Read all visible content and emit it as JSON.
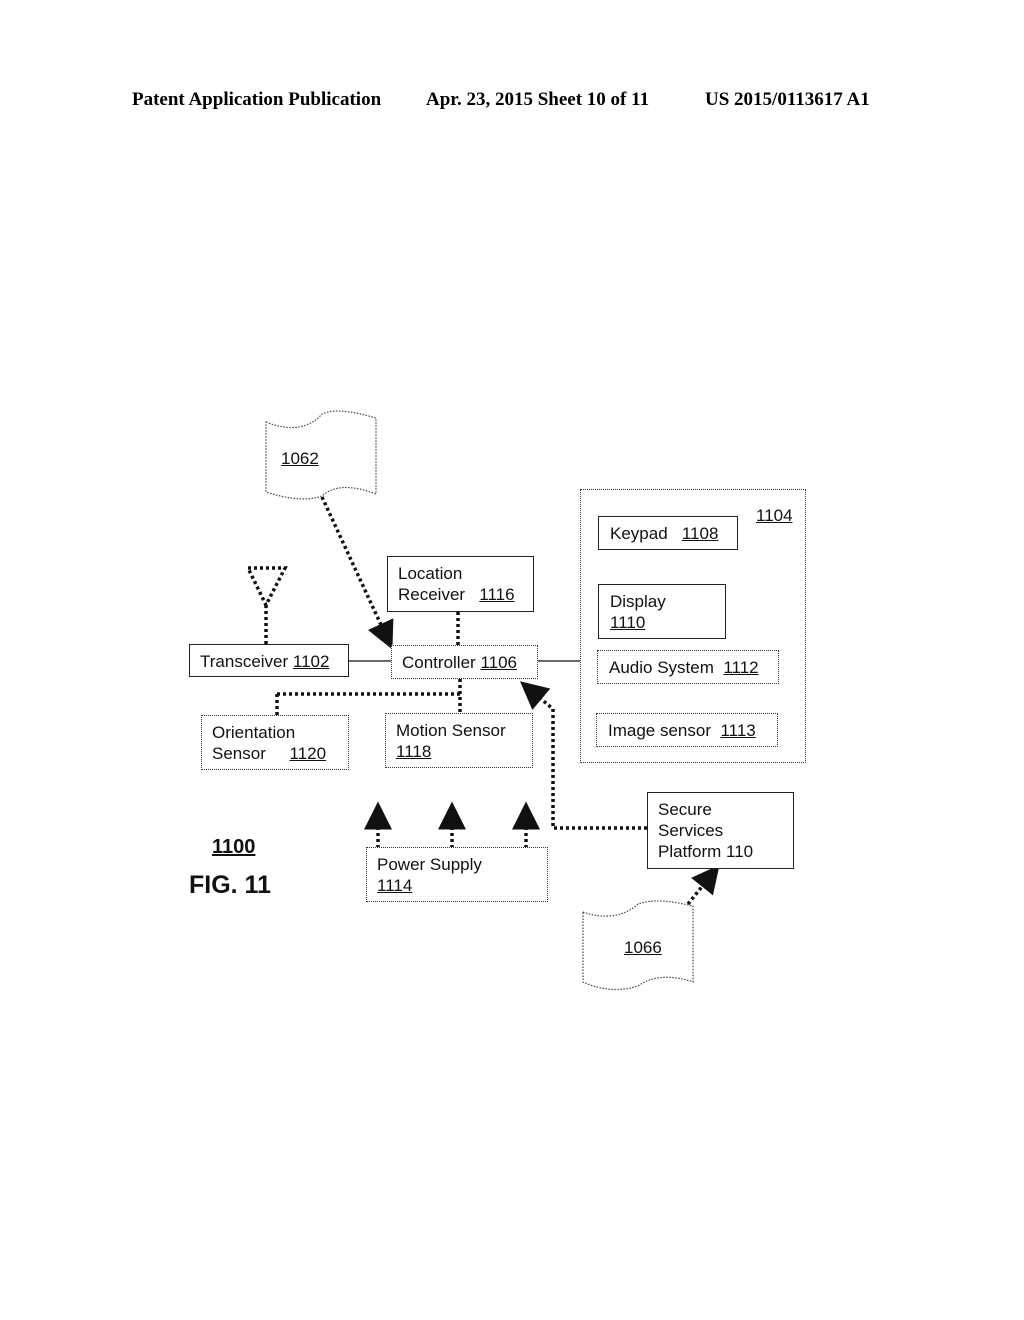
{
  "header": {
    "publication": "Patent Application Publication",
    "date_sheet": "Apr. 23, 2015  Sheet 10 of 11",
    "number": "US 2015/0113617 A1"
  },
  "figure": {
    "ref": "1100",
    "name": "FIG. 11"
  },
  "documents": {
    "doc_1062": "1062",
    "doc_1066": "1066"
  },
  "blocks": {
    "transceiver": {
      "label": "Transceiver",
      "ref": "1102"
    },
    "controller": {
      "label": "Controller",
      "ref": "1106"
    },
    "location_receiver": {
      "label1": "Location",
      "label2": "Receiver",
      "ref": "1116"
    },
    "orientation_sensor": {
      "label1": "Orientation",
      "label2": "Sensor",
      "ref": "1120"
    },
    "motion_sensor": {
      "label": "Motion Sensor",
      "ref": "1118"
    },
    "power_supply": {
      "label": "Power Supply",
      "ref": "1114"
    },
    "secure_services": {
      "label1": "Secure",
      "label2": "Services",
      "label3": "Platform 110"
    },
    "ui_group": {
      "ref": "1104"
    },
    "keypad": {
      "label": "Keypad",
      "ref": "1108"
    },
    "display": {
      "label": "Display",
      "ref": "1110"
    },
    "audio_system": {
      "label": "Audio System",
      "ref": "1112"
    },
    "image_sensor": {
      "label": "Image sensor",
      "ref": "1113"
    }
  }
}
